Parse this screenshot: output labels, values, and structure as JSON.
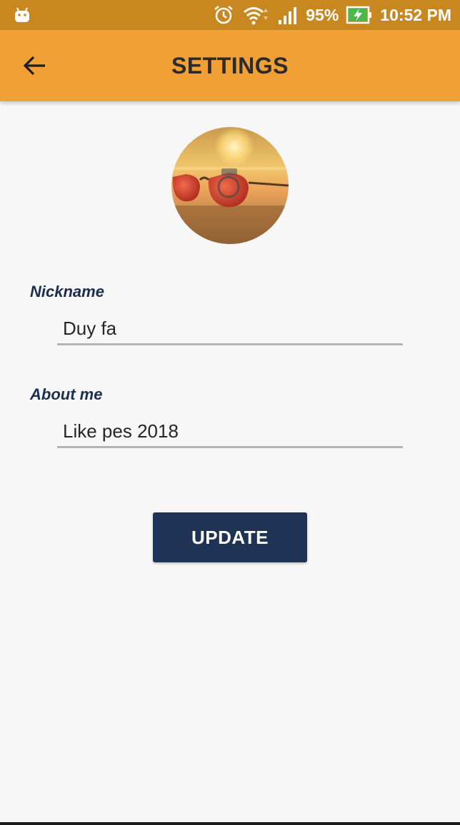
{
  "status_bar": {
    "battery_percent": "95%",
    "time": "10:52 PM",
    "icons": [
      "android-icon",
      "alarm-icon",
      "wifi-icon",
      "signal-icon",
      "battery-charging-icon"
    ]
  },
  "app_bar": {
    "title": "SETTINGS",
    "back_icon": "arrow-left-icon",
    "background_color": "#f0a035"
  },
  "profile": {
    "avatar_icon": "sunglasses-avatar"
  },
  "form": {
    "nickname": {
      "label": "Nickname",
      "value": "Duy fa"
    },
    "about": {
      "label": "About me",
      "value": "Like pes 2018"
    },
    "update_label": "UPDATE",
    "button_color": "#1f3354"
  }
}
